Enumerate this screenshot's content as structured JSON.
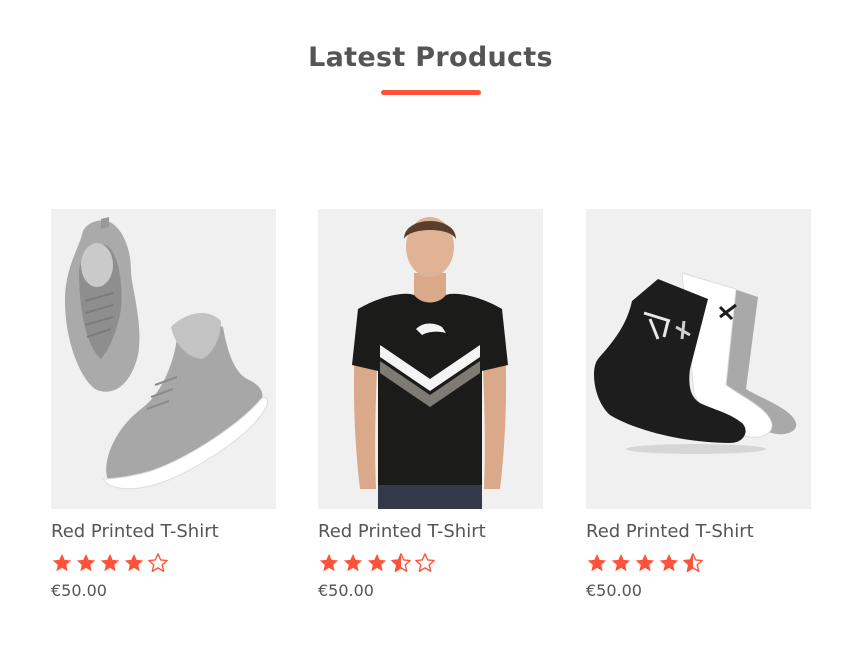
{
  "section": {
    "title": "Latest Products",
    "accent_color": "#ff523b"
  },
  "products": [
    {
      "name": "Red Printed T-Shirt",
      "rating": 4,
      "price": "€50.00",
      "image_icon": "sneakers-image"
    },
    {
      "name": "Red Printed T-Shirt",
      "rating": 3.5,
      "price": "€50.00",
      "image_icon": "tshirt-model-image"
    },
    {
      "name": "Red Printed T-Shirt",
      "rating": 4.5,
      "price": "€50.00",
      "image_icon": "socks-image"
    }
  ],
  "icons": {
    "star_full": "star-icon",
    "star_half": "star-half-icon",
    "star_empty": "star-empty-icon"
  },
  "colors": {
    "star": "#ff523b",
    "text": "#555555",
    "image_bg": "#f0f0f0"
  }
}
